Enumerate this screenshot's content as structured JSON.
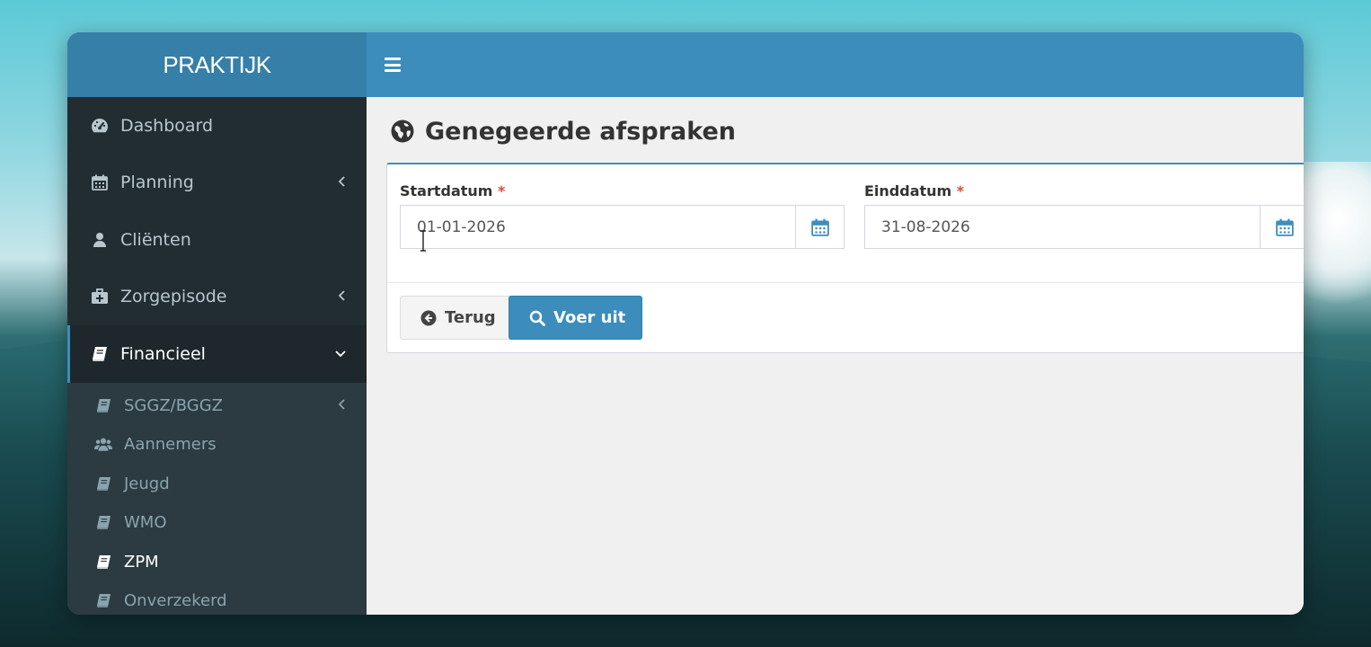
{
  "app": {
    "brand": "PRAKTIJK"
  },
  "sidebar": {
    "items": [
      {
        "label": "Dashboard",
        "icon": "dashboard-icon",
        "has_children": false
      },
      {
        "label": "Planning",
        "icon": "calendar-icon",
        "has_children": true
      },
      {
        "label": "Cliënten",
        "icon": "user-icon",
        "has_children": false
      },
      {
        "label": "Zorgepisode",
        "icon": "medkit-icon",
        "has_children": true
      },
      {
        "label": "Financieel",
        "icon": "book-icon",
        "has_children": true,
        "expanded": true
      }
    ],
    "submenu": [
      {
        "label": "SGGZ/BGGZ",
        "icon": "book-icon",
        "has_children": true
      },
      {
        "label": "Aannemers",
        "icon": "users-icon",
        "has_children": false
      },
      {
        "label": "Jeugd",
        "icon": "book-icon",
        "has_children": false
      },
      {
        "label": "WMO",
        "icon": "book-icon",
        "has_children": false
      },
      {
        "label": "ZPM",
        "icon": "book-icon",
        "has_children": false,
        "current": true
      },
      {
        "label": "Onverzekerd",
        "icon": "book-icon",
        "has_children": false
      }
    ]
  },
  "page": {
    "title": "Genegeerde afspraken",
    "title_icon": "globe-icon"
  },
  "form": {
    "start": {
      "label": "Startdatum",
      "required_mark": "*",
      "value": "01-01-2026"
    },
    "end": {
      "label": "Einddatum",
      "required_mark": "*",
      "value": "31-08-2026"
    },
    "back_button": "Terug",
    "submit_button": "Voer uit"
  },
  "colors": {
    "header": "#3c8dbc",
    "logo_bg": "#367fa9",
    "sidebar_bg": "#222d32",
    "submenu_bg": "#2c3b41",
    "required": "#dd4b39"
  }
}
